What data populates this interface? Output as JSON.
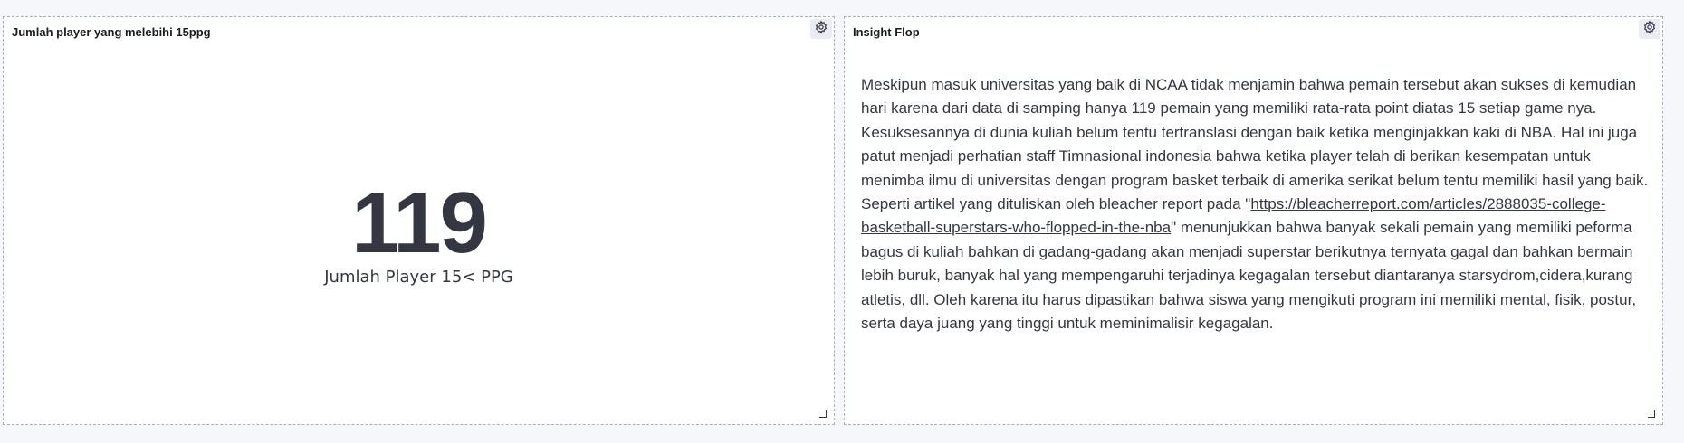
{
  "left_panel": {
    "title": "Jumlah player yang melebihi 15ppg",
    "metric_value": "119",
    "metric_label": "Jumlah Player 15< PPG",
    "gear_icon": "gear-icon"
  },
  "right_panel": {
    "title": "Insight Flop",
    "text_before_link": "Meskipun masuk universitas yang baik di NCAA tidak menjamin bahwa pemain tersebut akan sukses di kemudian hari karena dari data di samping hanya 119 pemain yang memiliki rata-rata point diatas 15 setiap game nya. Kesuksesannya di dunia kuliah belum tentu tertranslasi dengan baik ketika menginjakkan kaki di NBA. Hal ini juga patut menjadi perhatian staff Timnasional indonesia bahwa ketika player telah di berikan kesempatan untuk menimba ilmu di universitas dengan program basket terbaik di amerika serikat belum tentu memiliki hasil yang baik. Seperti artikel yang dituliskan oleh bleacher report pada \"",
    "link_text": "https://bleacherreport.com/articles/2888035-college-basketball-superstars-who-flopped-in-the-nba",
    "text_after_link": "\" menunjukkan bahwa banyak sekali pemain yang memiliki peforma bagus di kuliah bahkan di gadang-gadang akan menjadi superstar berikutnya ternyata gagal dan bahkan bermain lebih buruk, banyak hal yang mempengaruhi terjadinya kegagalan tersebut diantaranya starsydrom,cidera,kurang atletis, dll. Oleh karena itu harus dipastikan bahwa siswa yang mengikuti program ini memiliki mental, fisik, postur, serta daya juang yang tinggi untuk meminimalisir kegagalan.",
    "gear_icon": "gear-icon"
  },
  "colors": {
    "background": "#f5f7fa",
    "panel": "#ffffff",
    "text": "#343741",
    "border": "#a8aec0"
  }
}
